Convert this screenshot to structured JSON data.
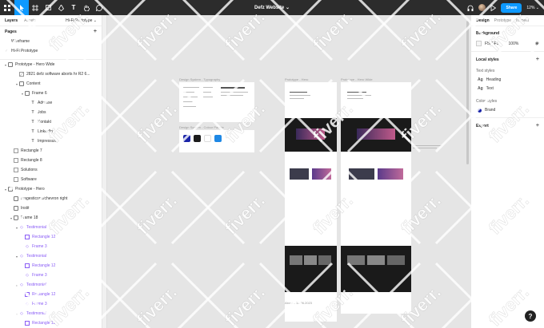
{
  "toolbar": {
    "title": "Defz Website",
    "share_label": "Share",
    "zoom_label": "12%",
    "tools": [
      "main-menu",
      "move",
      "frame",
      "shape",
      "pen",
      "text",
      "hand",
      "comment"
    ]
  },
  "left_panel": {
    "tabs": [
      "Layers",
      "Assets"
    ],
    "current_page": "Hi-Fi Prototype",
    "pages_title": "Pages",
    "pages": [
      {
        "label": "Wireframe",
        "active": false
      },
      {
        "label": "Hi-Fi Prototype",
        "active": true
      }
    ],
    "layers": [
      {
        "label": "Prototype - Hero Wide",
        "type": "frame",
        "indent": 0,
        "caret": true
      },
      {
        "label": "2821 defz software aborts hr  R2 6...",
        "type": "image",
        "indent": 2,
        "caret": false
      },
      {
        "label": "Content",
        "type": "frame",
        "indent": 2,
        "caret": true
      },
      {
        "label": "Frame 6",
        "type": "frame",
        "indent": 3,
        "caret": true
      },
      {
        "label": "Adresse",
        "type": "text",
        "indent": 4,
        "caret": false
      },
      {
        "label": "Jobs",
        "type": "text",
        "indent": 4,
        "caret": false
      },
      {
        "label": "Kontakt",
        "type": "text",
        "indent": 4,
        "caret": false
      },
      {
        "label": "LinkedIn",
        "type": "text",
        "indent": 4,
        "caret": false
      },
      {
        "label": "Impressum",
        "type": "text",
        "indent": 4,
        "caret": false
      },
      {
        "label": "Rectangle 7",
        "type": "rect",
        "indent": 1,
        "caret": false
      },
      {
        "label": "Rectangle 8",
        "type": "rect",
        "indent": 1,
        "caret": false
      },
      {
        "label": "Solutions",
        "type": "rect",
        "indent": 1,
        "caret": false
      },
      {
        "label": "Software",
        "type": "rect",
        "indent": 1,
        "caret": false
      },
      {
        "label": "Prototype - Hero",
        "type": "frame",
        "indent": 0,
        "caret": true
      },
      {
        "label": "magesticons/chevron right",
        "type": "frame",
        "indent": 1,
        "caret": false
      },
      {
        "label": "Instit",
        "type": "frame",
        "indent": 1,
        "caret": false
      },
      {
        "label": "Frame 18",
        "type": "frame",
        "indent": 1,
        "caret": true
      },
      {
        "label": "Testimonial",
        "type": "comp",
        "indent": 2,
        "caret": true
      },
      {
        "label": "Rectangle 12",
        "type": "rect-p",
        "indent": 3,
        "caret": false
      },
      {
        "label": "Frame 3",
        "type": "comp",
        "indent": 3,
        "caret": false
      },
      {
        "label": "Testimonial",
        "type": "comp",
        "indent": 2,
        "caret": true
      },
      {
        "label": "Rectangle 12",
        "type": "rect-p",
        "indent": 3,
        "caret": false
      },
      {
        "label": "Frame 3",
        "type": "comp",
        "indent": 3,
        "caret": false
      },
      {
        "label": "Testimonial",
        "type": "comp",
        "indent": 2,
        "caret": true
      },
      {
        "label": "Rectangle 12",
        "type": "rect-p",
        "indent": 3,
        "caret": false
      },
      {
        "label": "Frame 3",
        "type": "comp",
        "indent": 3,
        "caret": false
      },
      {
        "label": "Testimonial",
        "type": "comp",
        "indent": 2,
        "caret": true
      },
      {
        "label": "Rectangle 12",
        "type": "rect-p",
        "indent": 3,
        "caret": false
      }
    ]
  },
  "right_panel": {
    "tabs": [
      "Design",
      "Prototype",
      "Inspect"
    ],
    "background_title": "Background",
    "background_hex": "F5F5F5",
    "background_opacity": "100%",
    "local_styles_title": "Local styles",
    "text_styles_title": "Text styles",
    "text_styles": [
      "Heading",
      "Text"
    ],
    "color_styles_title": "Color styles",
    "color_styles": [
      "Brand"
    ],
    "export_title": "Export"
  },
  "canvas": {
    "frame_labels": {
      "typography": "Design System - Typography",
      "palette": "Design System - Colour Palette",
      "hero": "Prototype - Hero",
      "hero_wide": "Prototype - Hero Wide",
      "about": "About - 15.06.2023"
    },
    "palette_colors": [
      "#1a24a8",
      "#1c1c1c",
      "#ffffff",
      "#1e88e5"
    ]
  },
  "watermark_text": "fiverr."
}
